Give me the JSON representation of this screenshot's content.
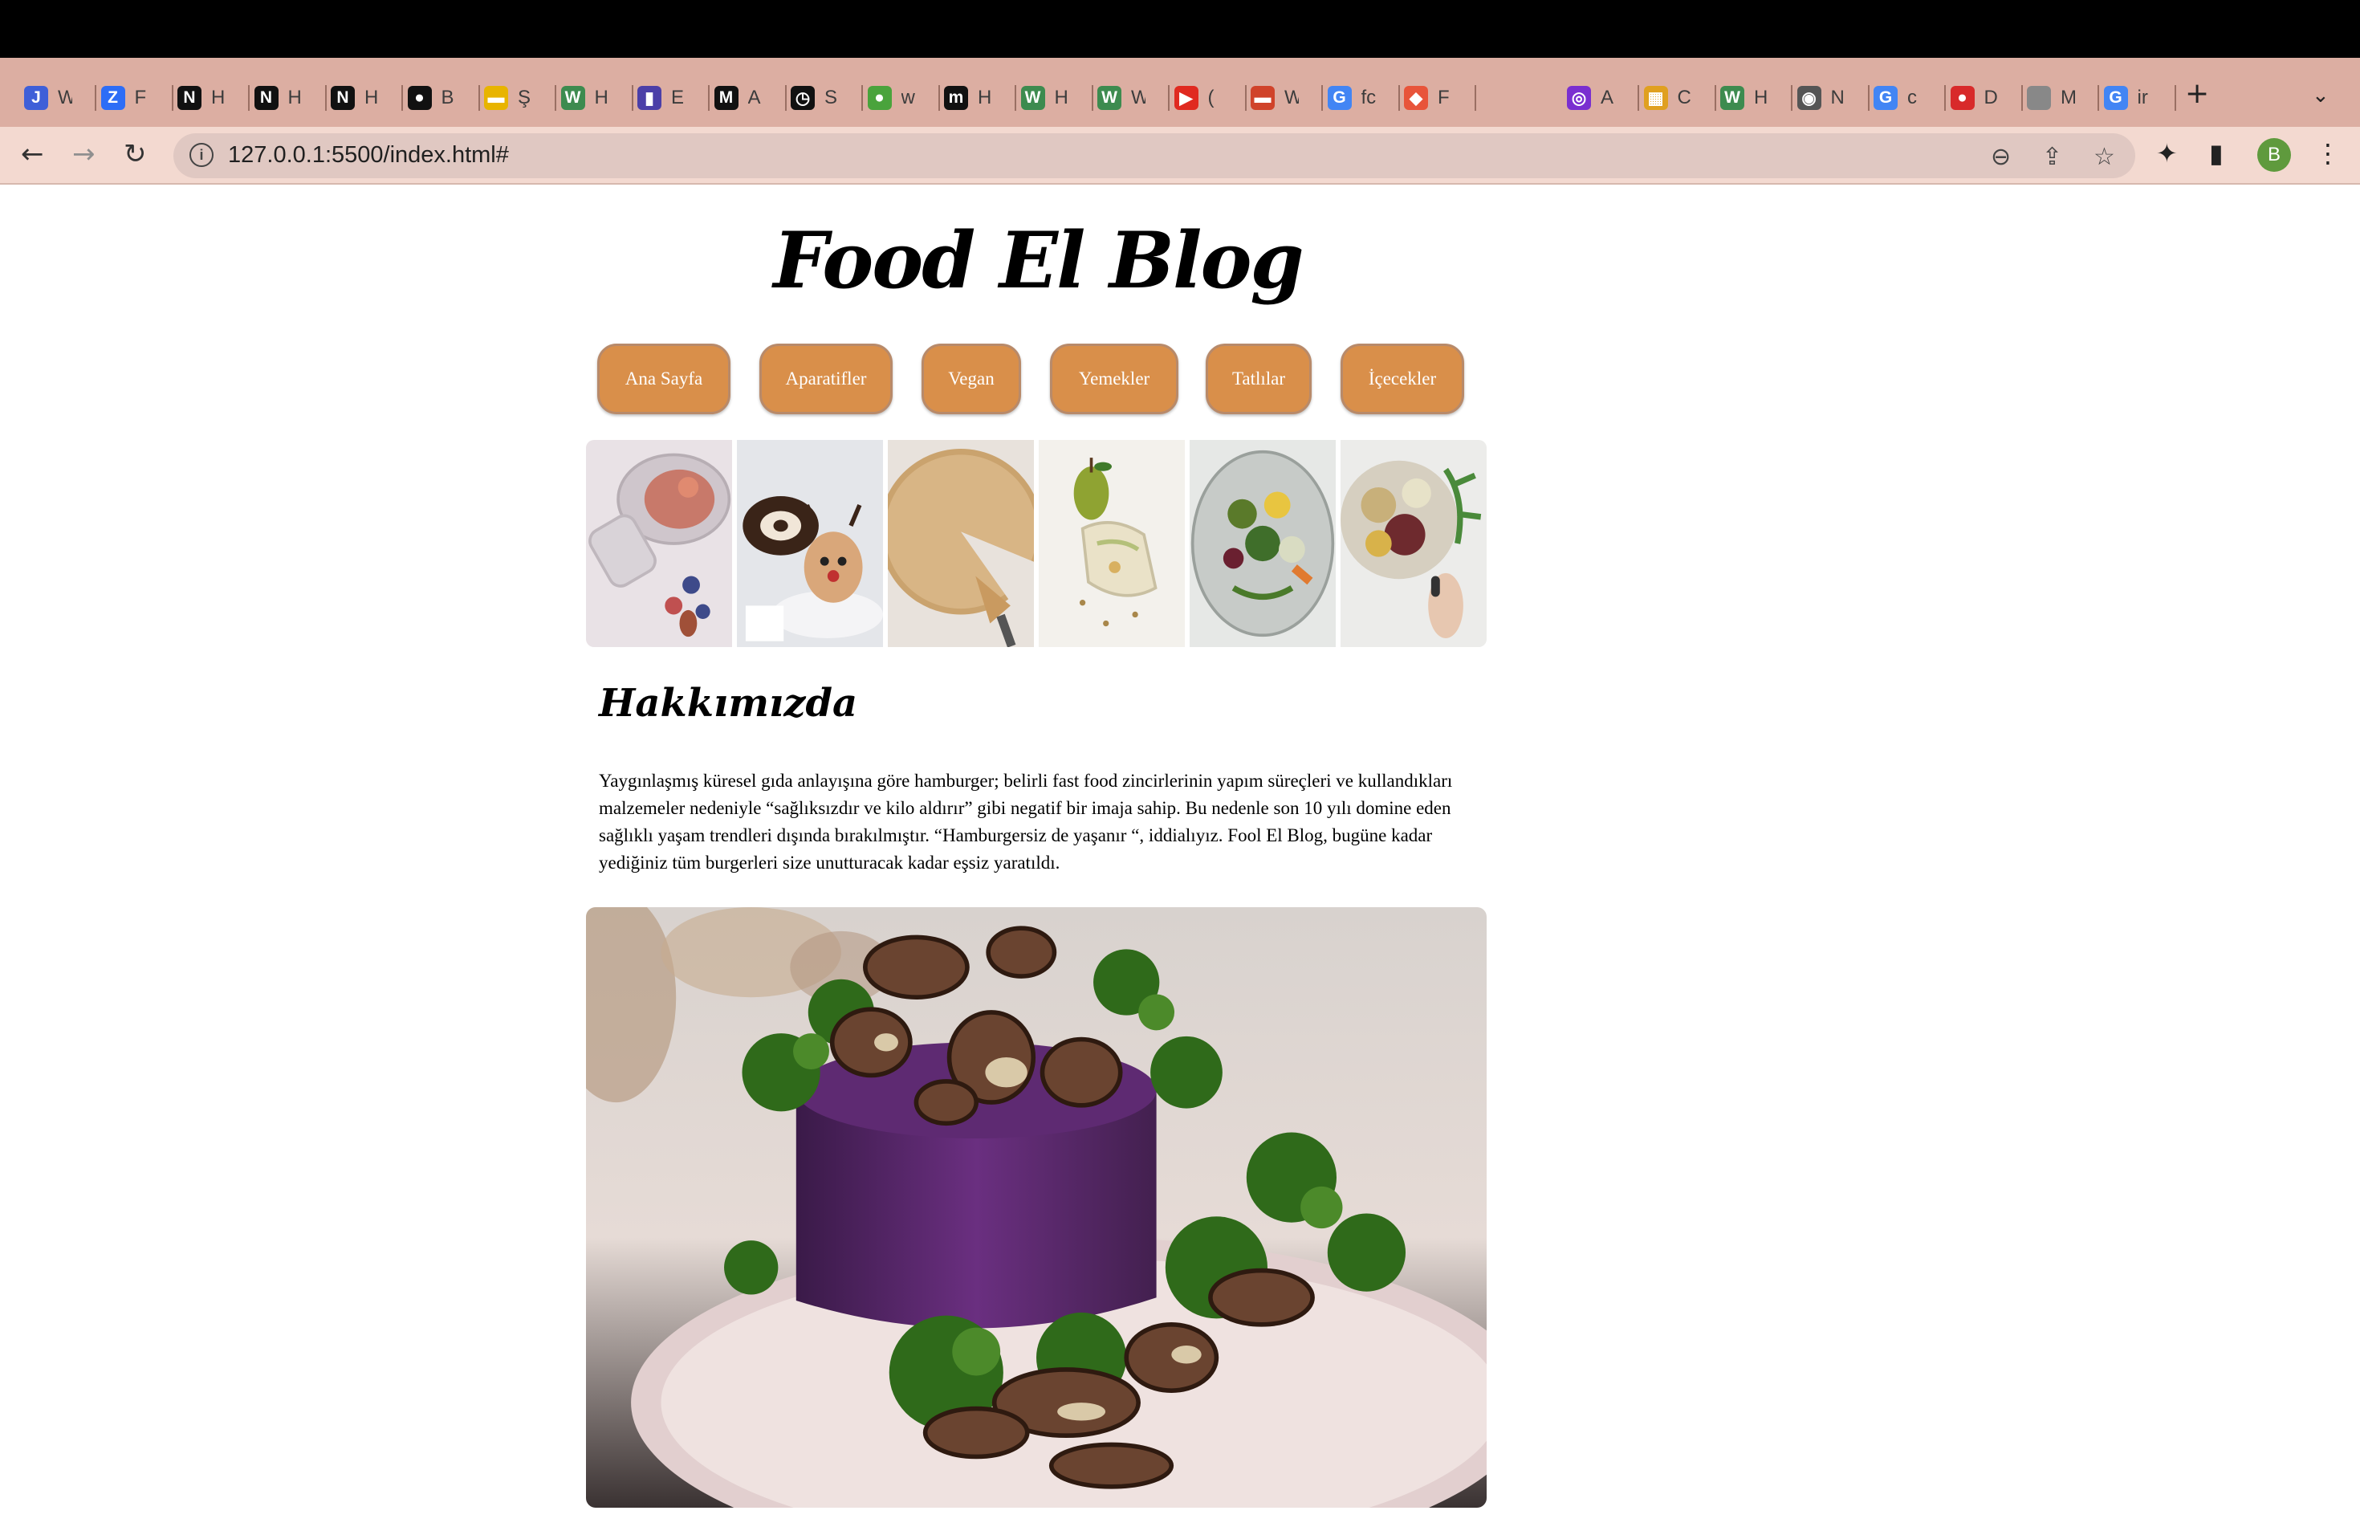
{
  "browser": {
    "tabs": [
      {
        "letter": "J",
        "title": "W",
        "color": "#3e5fd8"
      },
      {
        "letter": "Z",
        "title": "F",
        "color": "#2d6df6"
      },
      {
        "letter": "N",
        "title": "H",
        "color": "#111111"
      },
      {
        "letter": "N",
        "title": "H",
        "color": "#111111"
      },
      {
        "letter": "N",
        "title": "H",
        "color": "#111111"
      },
      {
        "letter": "●",
        "title": "B",
        "color": "#111111"
      },
      {
        "letter": "▬",
        "title": "Ş",
        "color": "#e8b400"
      },
      {
        "letter": "W",
        "title": "H",
        "color": "#3d8b4f"
      },
      {
        "letter": "▮",
        "title": "E",
        "color": "#4b3fa8"
      },
      {
        "letter": "M",
        "title": "A",
        "color": "#111111"
      },
      {
        "letter": "◷",
        "title": "S",
        "color": "#111111"
      },
      {
        "letter": "●",
        "title": "w",
        "color": "#4aa33c"
      },
      {
        "letter": "m",
        "title": "H",
        "color": "#111111"
      },
      {
        "letter": "W",
        "title": "H",
        "color": "#3d8b4f"
      },
      {
        "letter": "W",
        "title": "W",
        "color": "#3d8b4f"
      },
      {
        "letter": "▶",
        "title": "(",
        "color": "#e02a20"
      },
      {
        "letter": "▬",
        "title": "W",
        "color": "#d0432a"
      },
      {
        "letter": "G",
        "title": "fc",
        "color": "#4285f4"
      },
      {
        "letter": "◆",
        "title": "F",
        "color": "#e8543a"
      }
    ],
    "tabs_after": [
      {
        "letter": "◎",
        "title": "A",
        "color": "#7a2fd0"
      },
      {
        "letter": "▦",
        "title": "C",
        "color": "#e0a020"
      },
      {
        "letter": "W",
        "title": "H",
        "color": "#3d8b4f"
      },
      {
        "letter": "◉",
        "title": "N",
        "color": "#555555"
      },
      {
        "letter": "G",
        "title": "c",
        "color": "#4285f4"
      },
      {
        "letter": "●",
        "title": "D",
        "color": "#d82a2a"
      },
      {
        "letter": "",
        "title": "M",
        "color": "#888888"
      },
      {
        "letter": "G",
        "title": "ir",
        "color": "#4285f4"
      }
    ],
    "active_tab_close": "✕",
    "new_tab": "+",
    "tab_menu": "⌄",
    "url": "127.0.0.1:5500/index.html#",
    "back": "←",
    "forward": "→",
    "reload": "↻",
    "info": "i",
    "zoom": "⊖",
    "share": "⇪",
    "bookmark": "☆",
    "extensions": "✦",
    "sidepanel": "▮",
    "profile": "B",
    "menu": "⋮"
  },
  "page": {
    "title": "Food El Blog",
    "nav": [
      "Ana Sayfa",
      "Aparatifler",
      "Vegan",
      "Yemekler",
      "Tatlılar",
      "İçecekler"
    ],
    "about_title": "Hakkımızda",
    "about_text": "Yaygınlaşmış küresel gıda anlayışına göre hamburger; belirli fast food zincirlerinin yapım süreçleri ve kullandıkları malzemeler nedeniyle “sağlıksızdır ve kilo aldırır” gibi negatif bir imaja sahip. Bu nedenle son 10 yılı domine eden sağlıklı yaşam trendleri dışında bırakılmıştır. “Hamburgersiz de yaşanır “, iddialıyız. Fool El Blog, bugüne kadar yediğiniz tüm burgerleri size unutturacak kadar eşsiz yaratıldı."
  }
}
